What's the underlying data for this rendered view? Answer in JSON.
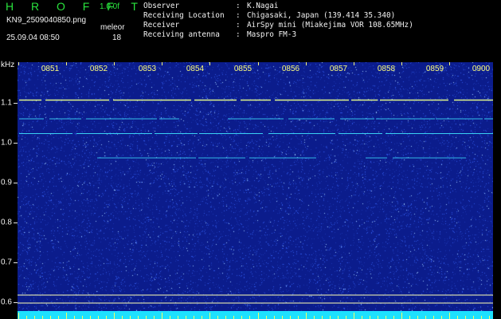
{
  "header": {
    "app_name": "H R O F F T",
    "version": "1.0.0f",
    "filename": "KN9_2509040850.png",
    "datetime": "25.09.04 08:50",
    "mode": "meleor",
    "count": "18"
  },
  "metadata": [
    {
      "key": "Observer",
      "sep": ":",
      "value": "K.Nagai"
    },
    {
      "key": "Receiving Location",
      "sep": ":",
      "value": "Chigasaki, Japan (139.414 35.340)"
    },
    {
      "key": "Receiver",
      "sep": ":",
      "value": "AirSpy mini (Miakejima VOR 108.65MHz)"
    },
    {
      "key": "Receiving antenna",
      "sep": ":",
      "value": "Maspro FM-3"
    }
  ],
  "spectrogram": {
    "frequency_unit": "kHz",
    "frequency_range": [
      0.58,
      1.18
    ],
    "time_labels": [
      "0851",
      "0852",
      "0853",
      "0854",
      "0855",
      "0856",
      "0857",
      "0858",
      "0859",
      "0900"
    ],
    "frequency_labels": [
      "1.1",
      "1.0",
      "0.9",
      "0.8",
      "0.7",
      "0.6"
    ],
    "frequency_ticks": [
      1.1,
      1.0,
      0.9,
      0.8,
      0.7,
      0.6
    ],
    "colors": {
      "background": "#0b1c8c",
      "noise_dim": "#2e55e6",
      "noise_bright": "#9ac8ff",
      "carrier": "#3fe6ff",
      "carrier_hot": "#eaff8c",
      "reference_line": "#ffffb0",
      "time_label": "#ffff7a",
      "bottom_bar": "#1de1ff"
    },
    "carrier_lines": [
      {
        "frequency": 1.107,
        "intensity": 1.0
      },
      {
        "frequency": 1.06,
        "intensity": 0.65
      },
      {
        "frequency": 1.023,
        "intensity": 0.85
      },
      {
        "frequency": 0.962,
        "intensity": 0.55
      }
    ],
    "reference_lines": [
      0.618,
      0.598
    ]
  }
}
